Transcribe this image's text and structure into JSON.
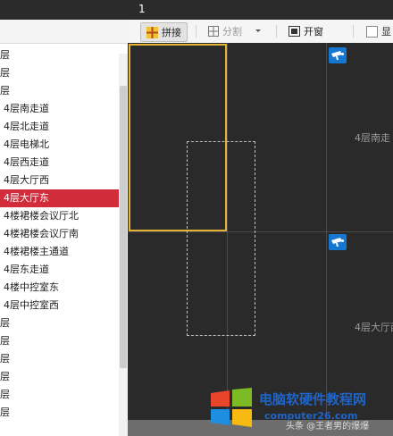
{
  "topbar": {
    "tab_number": "1"
  },
  "toolbar": {
    "splice_label": "拼接",
    "split_label": "分割",
    "open_window_label": "开窗",
    "display_label": "显"
  },
  "tree": {
    "items": [
      {
        "label": "层"
      },
      {
        "label": "层"
      },
      {
        "label": "层"
      },
      {
        "label": "4层南走道"
      },
      {
        "label": "4层北走道"
      },
      {
        "label": "4层电梯北"
      },
      {
        "label": "4层西走道"
      },
      {
        "label": "4层大厅西"
      },
      {
        "label": "4层大厅东",
        "selected": true
      },
      {
        "label": "4楼裙楼会议厅北"
      },
      {
        "label": "4楼裙楼会议厅南"
      },
      {
        "label": "4楼裙楼主通道"
      },
      {
        "label": "4层东走道"
      },
      {
        "label": "4楼中控室东"
      },
      {
        "label": "4层中控室西"
      },
      {
        "label": "层"
      },
      {
        "label": "层"
      },
      {
        "label": "层"
      },
      {
        "label": "层"
      },
      {
        "label": "层"
      },
      {
        "label": "层"
      }
    ]
  },
  "wall": {
    "cells": [
      {
        "label": "4层南走"
      },
      {
        "label": "4层大厅西"
      }
    ]
  },
  "watermark": {
    "title": "电脑软硬件教程网",
    "url": "computer26.com",
    "credit": "头条 @王者男的爆爆"
  },
  "colors": {
    "selection": "#d22b3a",
    "accent_frame": "#e5b23a",
    "camera_badge": "#1677d2"
  }
}
